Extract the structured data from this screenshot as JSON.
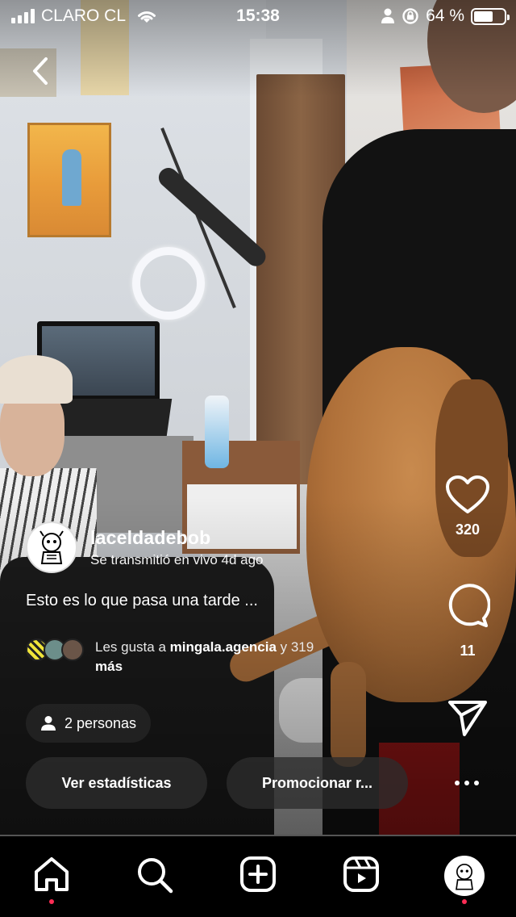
{
  "status_bar": {
    "carrier": "CLARO CL",
    "time": "15:38",
    "battery_percent": "64 %",
    "battery_level": 0.64
  },
  "author": {
    "username": "laceldadebob",
    "subtitle": "Se transmitió en vivo 4d ago"
  },
  "caption": "Esto es lo que pasa una tarde ...",
  "likes": {
    "prefix": "Les gusta a ",
    "highlight_user": "mingala.agencia",
    "suffix": " y 319",
    "more": "más"
  },
  "actions": {
    "like_count": "320",
    "comment_count": "11"
  },
  "viewers": {
    "label": "2 personas"
  },
  "buttons": {
    "insights": "Ver estadísticas",
    "promote": "Promocionar r..."
  },
  "tab_bar": {
    "items": [
      "home-icon",
      "search-icon",
      "create-icon",
      "reels-icon",
      "profile-avatar"
    ],
    "dot_color": "#ff2d55"
  }
}
